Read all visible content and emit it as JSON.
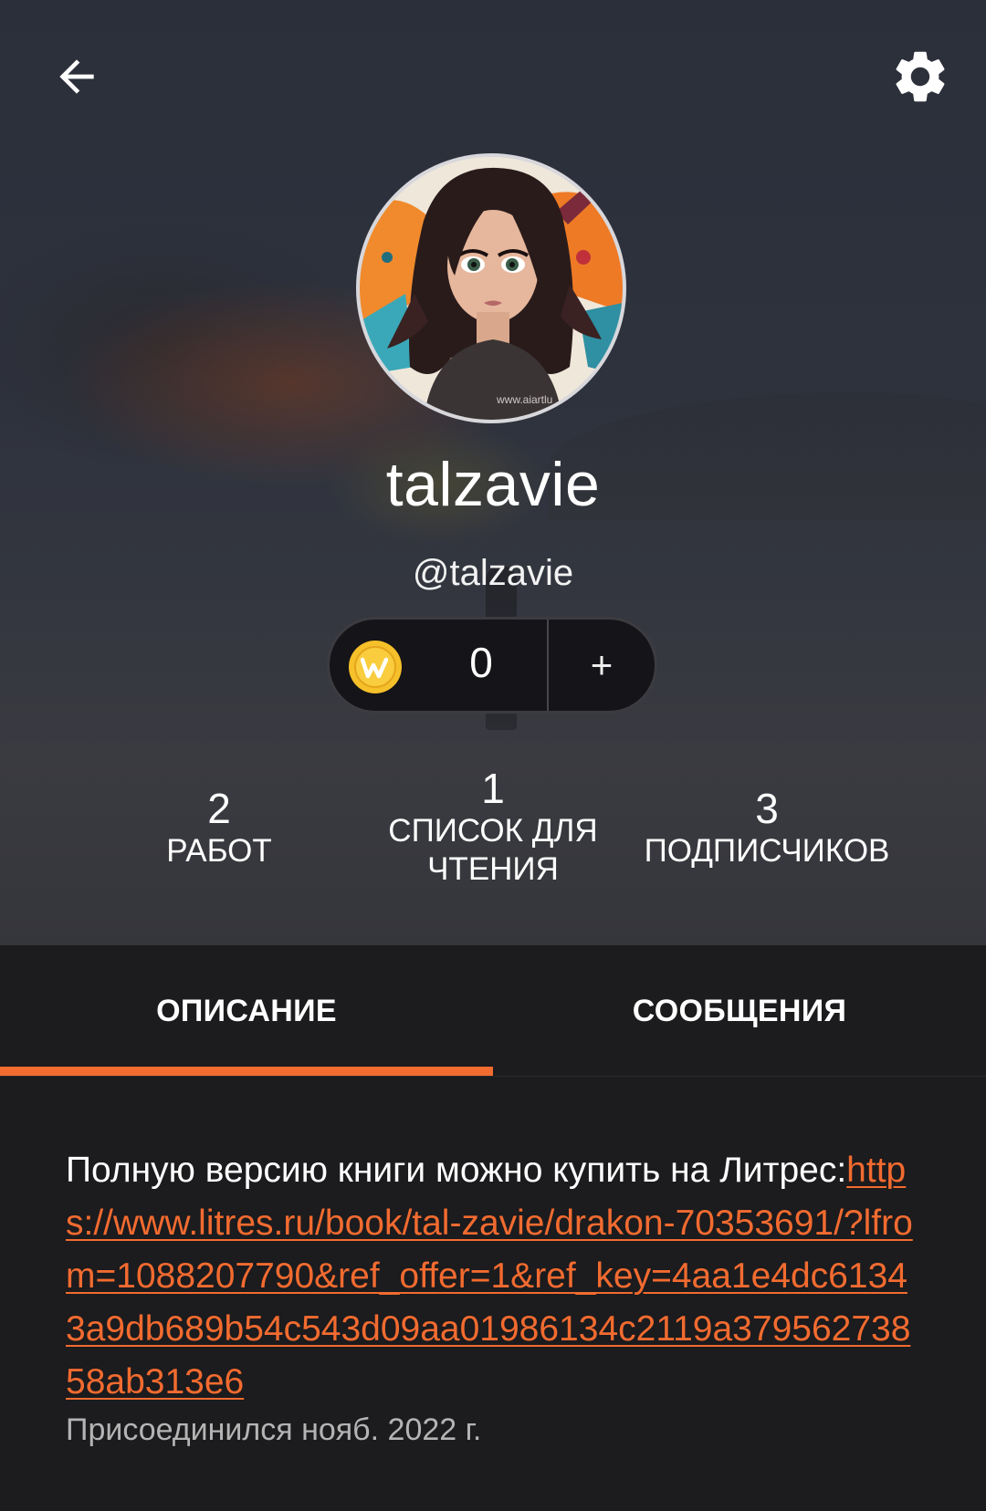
{
  "header": {
    "back_icon": "arrow-left-icon",
    "settings_icon": "gear-icon"
  },
  "profile": {
    "display_name": "talzavie",
    "handle": "@talzavie",
    "avatar_watermark": "www.aiartlu"
  },
  "coins": {
    "icon": "coin-w-icon",
    "value": "0",
    "add_label": "+"
  },
  "stats": [
    {
      "value": "2",
      "label": "РАБОТ"
    },
    {
      "value": "1",
      "label": "СПИСОК ДЛЯ ЧТЕНИЯ"
    },
    {
      "value": "3",
      "label": "ПОДПИСЧИКОВ"
    }
  ],
  "tabs": [
    {
      "label": "ОПИСАНИЕ",
      "active": true
    },
    {
      "label": "СООБЩЕНИЯ",
      "active": false
    }
  ],
  "about": {
    "text": "Полную версию книги можно купить на Литрес:",
    "link": "https://www.litres.ru/book/tal-zavie/drakon-70353691/?lfrom=1088207790&ref_offer=1&ref_key=4aa1e4dc61343a9db689b54c543d09aa01986134c2119a37956273858ab313e6",
    "joined": "Присоединился нояб. 2022 г."
  },
  "colors": {
    "accent": "#f26b30",
    "background": "#1c1b1d",
    "coin": "#f6c02a"
  }
}
